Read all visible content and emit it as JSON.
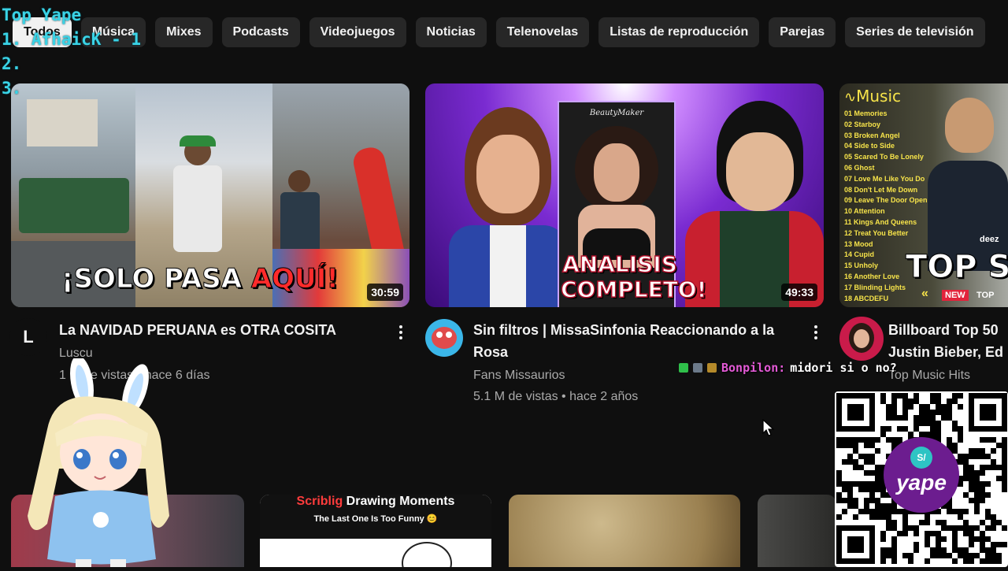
{
  "overlay": {
    "title": "Top Yape",
    "lines": [
      "1. AfhaicK - 1",
      "2.",
      "3."
    ]
  },
  "chips": [
    "Todos",
    "Música",
    "Mixes",
    "Podcasts",
    "Videojuegos",
    "Noticias",
    "Telenovelas",
    "Listas de reproducción",
    "Parejas",
    "Series de televisión"
  ],
  "videos": [
    {
      "title": "La NAVIDAD PERUANA es OTRA COSITA",
      "channel": "Luscu",
      "meta": "1 M de vistas • hace 6 días",
      "duration": "30:59",
      "thumb_caption_a": "¡SOLO PASA ",
      "thumb_caption_b": "AQUÍ!",
      "avatar_letter": "L"
    },
    {
      "title": "Sin filtros | MissaSinfonia Reaccionando a la Rosa",
      "channel": "Fans Missaurios",
      "meta": "5.1 M de vistas • hace 2 años",
      "duration": "49:33",
      "thumb_caption": "ANALISIS COMPLETO!",
      "thumb_card_label": "BeautyMaker"
    },
    {
      "title": "Billboard Top 50 Justin Bieber, Ed",
      "channel": "Top Music Hits",
      "thumb_brand": "Music",
      "thumb_caption": "TOP SO",
      "thumb_tag": "NEW",
      "thumb_tag2": "TOP",
      "thumb_deezer": "deez",
      "tracks": [
        "Memories",
        "Starboy",
        "Broken Angel",
        "Side to Side",
        "Scared To Be Lonely",
        "Ghost",
        "Love Me Like You Do",
        "Don't Let Me Down",
        "Leave The Door Open",
        "Attention",
        "Kings And Queens",
        "Treat You Better",
        "Mood",
        "Cupid",
        "Unholy",
        "Another Love",
        "Blinding Lights",
        "ABCDEFU"
      ]
    }
  ],
  "bottom_row": [
    {
      "thumb_title_a": "Scriblig",
      "thumb_title_b": " Drawing Moments",
      "thumb_subtitle": "The Last One Is Too Funny 😊"
    }
  ],
  "chat": {
    "name": "Bonpilon:",
    "message": "midori si o no?"
  },
  "qr": {
    "brand": "yape",
    "badge": "S/"
  },
  "colors": {
    "background": "#0f0f0f",
    "chip_bg": "#272727",
    "chip_active_bg": "#f1f1f1",
    "overlay_text": "#3ad3e6",
    "chat_name": "#e35ad6"
  }
}
